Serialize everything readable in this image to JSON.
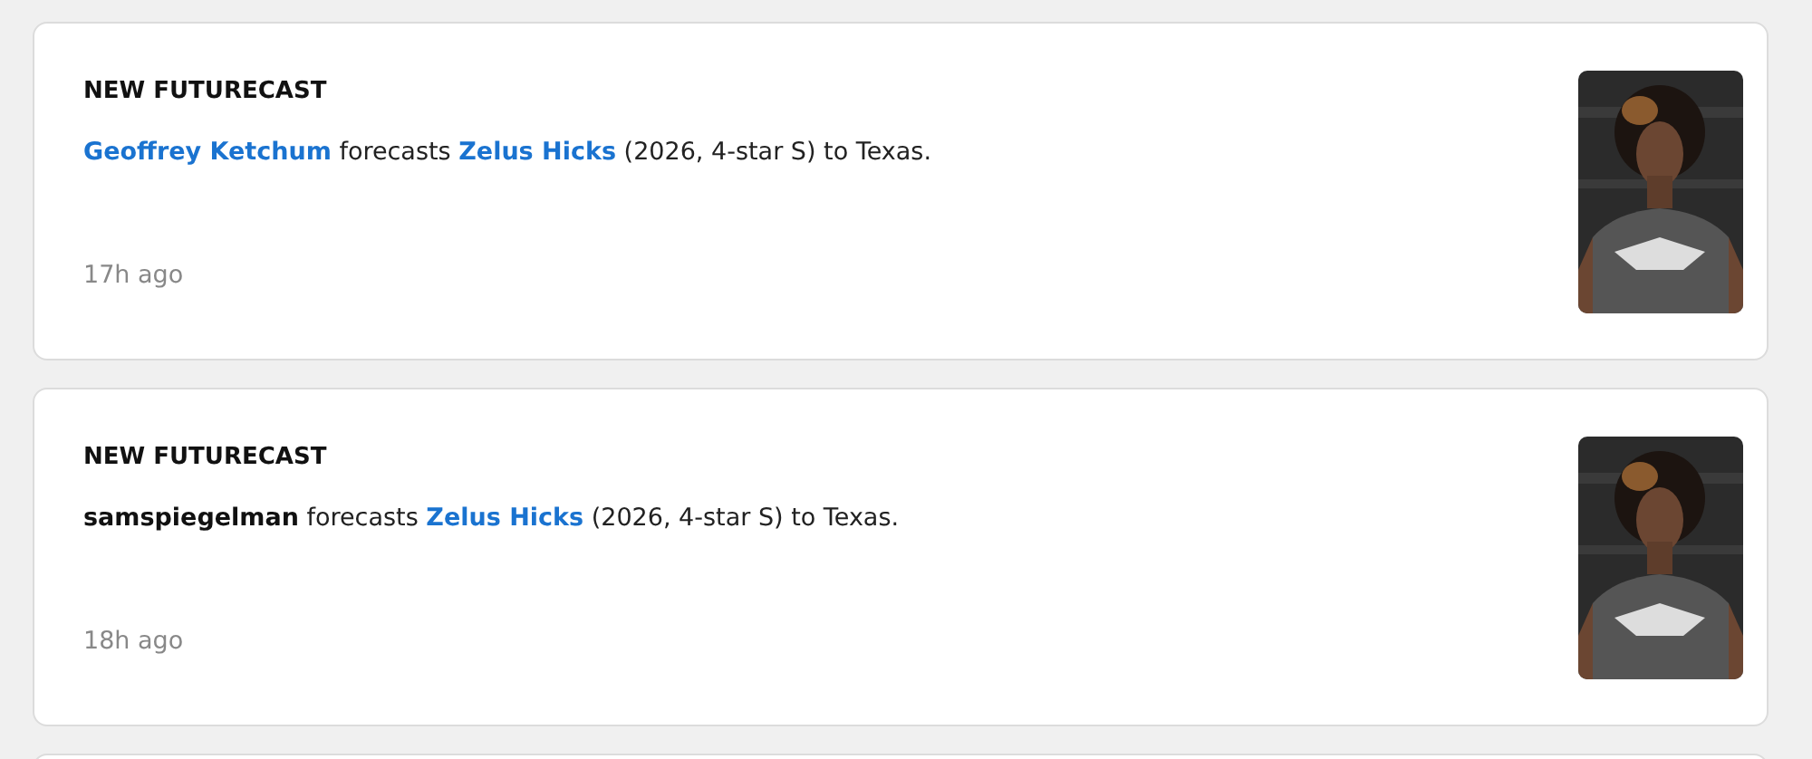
{
  "feed": [
    {
      "title": "NEW FUTURECAST",
      "sentence": [
        {
          "kind": "link",
          "text": "Geoffrey Ketchum"
        },
        {
          "kind": "text",
          "text": "forecasts"
        },
        {
          "kind": "link",
          "text": "Zelus Hicks"
        },
        {
          "kind": "text",
          "text": "(2026, 4-star S) to Texas."
        }
      ],
      "time": "17h ago"
    },
    {
      "title": "NEW FUTURECAST",
      "sentence": [
        {
          "kind": "bold",
          "text": "samspiegelman"
        },
        {
          "kind": "text",
          "text": "forecasts"
        },
        {
          "kind": "link",
          "text": "Zelus Hicks"
        },
        {
          "kind": "text",
          "text": "(2026, 4-star S) to Texas."
        }
      ],
      "time": "18h ago"
    }
  ]
}
